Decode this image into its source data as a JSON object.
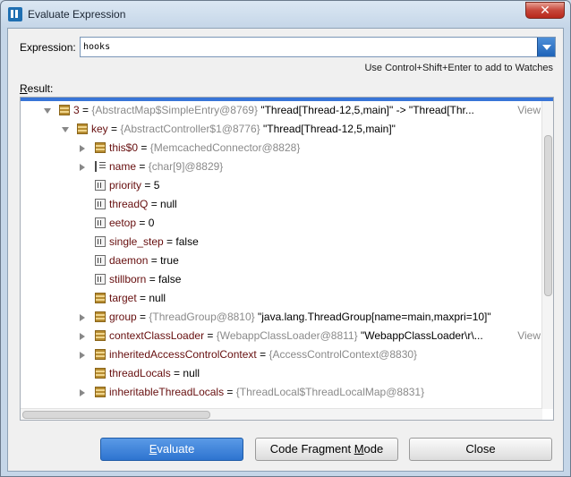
{
  "window": {
    "title": "Evaluate Expression",
    "close_glyph": "✕"
  },
  "expression": {
    "label": "Expression:",
    "value": "hooks"
  },
  "hint": "Use Control+Shift+Enter to add to Watches",
  "result_label": {
    "first": "R",
    "rest": "esult:"
  },
  "tree": {
    "rows": [
      {
        "name": "3",
        "eq": " = ",
        "type": "{AbstractMap$SimpleEntry@8769}",
        "value": " \"Thread[Thread-12,5,main]\" -> \"Thread[Thr...",
        "view": "View",
        "icon": "object",
        "arrow": "down",
        "depth": 0
      },
      {
        "name": "key",
        "eq": " = ",
        "type": "{AbstractController$1@8776}",
        "value": " \"Thread[Thread-12,5,main]\"",
        "view": "",
        "icon": "object",
        "arrow": "down",
        "depth": 1
      },
      {
        "name": "this$0",
        "eq": " = ",
        "type": "{MemcachedConnector@8828}",
        "value": "",
        "view": "",
        "icon": "object",
        "arrow": "right",
        "depth": 2
      },
      {
        "name": "name",
        "eq": " = ",
        "type": "{char[9]@8829}",
        "value": "",
        "view": "",
        "icon": "array",
        "arrow": "right",
        "depth": 2
      },
      {
        "name": "priority",
        "eq": " = ",
        "type": "",
        "value": "5",
        "view": "",
        "icon": "field",
        "arrow": "",
        "depth": 2
      },
      {
        "name": "threadQ",
        "eq": " = ",
        "type": "",
        "value": "null",
        "view": "",
        "icon": "field",
        "arrow": "",
        "depth": 2
      },
      {
        "name": "eetop",
        "eq": " = ",
        "type": "",
        "value": "0",
        "view": "",
        "icon": "field",
        "arrow": "",
        "depth": 2
      },
      {
        "name": "single_step",
        "eq": " = ",
        "type": "",
        "value": "false",
        "view": "",
        "icon": "field",
        "arrow": "",
        "depth": 2
      },
      {
        "name": "daemon",
        "eq": " = ",
        "type": "",
        "value": "true",
        "view": "",
        "icon": "field",
        "arrow": "",
        "depth": 2
      },
      {
        "name": "stillborn",
        "eq": " = ",
        "type": "",
        "value": "false",
        "view": "",
        "icon": "field",
        "arrow": "",
        "depth": 2
      },
      {
        "name": "target",
        "eq": " = ",
        "type": "",
        "value": "null",
        "view": "",
        "icon": "object",
        "arrow": "",
        "depth": 2
      },
      {
        "name": "group",
        "eq": " = ",
        "type": "{ThreadGroup@8810}",
        "value": " \"java.lang.ThreadGroup[name=main,maxpri=10]\"",
        "view": "",
        "icon": "object",
        "arrow": "right",
        "depth": 2
      },
      {
        "name": "contextClassLoader",
        "eq": " = ",
        "type": "{WebappClassLoader@8811}",
        "value": " \"WebappClassLoader\\r\\...",
        "view": "View",
        "icon": "object",
        "arrow": "right",
        "depth": 2
      },
      {
        "name": "inheritedAccessControlContext",
        "eq": " = ",
        "type": "{AccessControlContext@8830}",
        "value": "",
        "view": "",
        "icon": "object",
        "arrow": "right",
        "depth": 2
      },
      {
        "name": "threadLocals",
        "eq": " = ",
        "type": "",
        "value": "null",
        "view": "",
        "icon": "object",
        "arrow": "",
        "depth": 2
      },
      {
        "name": "inheritableThreadLocals",
        "eq": " = ",
        "type": "{ThreadLocal$ThreadLocalMap@8831}",
        "value": "",
        "view": "",
        "icon": "object",
        "arrow": "right",
        "depth": 2
      }
    ]
  },
  "buttons": {
    "evaluate_mnemonic": "E",
    "evaluate_rest": "valuate",
    "fragment_pre": "Code Fragment ",
    "fragment_mnemonic": "M",
    "fragment_post": "ode",
    "close": "Close"
  },
  "colors": {
    "accent": "#3875d7",
    "field_name": "#660e0e",
    "type_gray": "#8a8a8a"
  }
}
